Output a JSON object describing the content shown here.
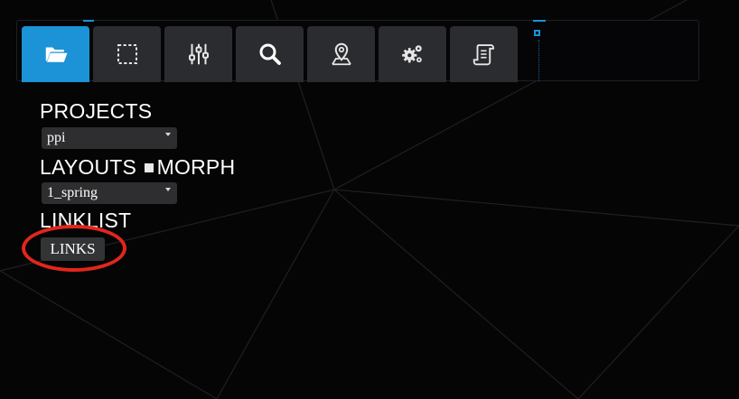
{
  "toolbar": {
    "tabs": [
      {
        "icon": "folder-open-icon",
        "active": true
      },
      {
        "icon": "selection-icon",
        "active": false
      },
      {
        "icon": "sliders-icon",
        "active": false
      },
      {
        "icon": "search-icon",
        "active": false
      },
      {
        "icon": "map-pin-icon",
        "active": false
      },
      {
        "icon": "gears-icon",
        "active": false
      },
      {
        "icon": "scroll-icon",
        "active": false
      }
    ]
  },
  "panel": {
    "projects_label": "PROJECTS",
    "project_value": "ppi",
    "layouts_label": "LAYOUTS",
    "morph_label": "MORPH",
    "layout_value": "1_spring",
    "linklist_label": "LINKLIST",
    "links_button": "LINKS"
  },
  "colors": {
    "accent": "#1b93d6",
    "annotation": "#e2261c",
    "background": "#050506"
  }
}
